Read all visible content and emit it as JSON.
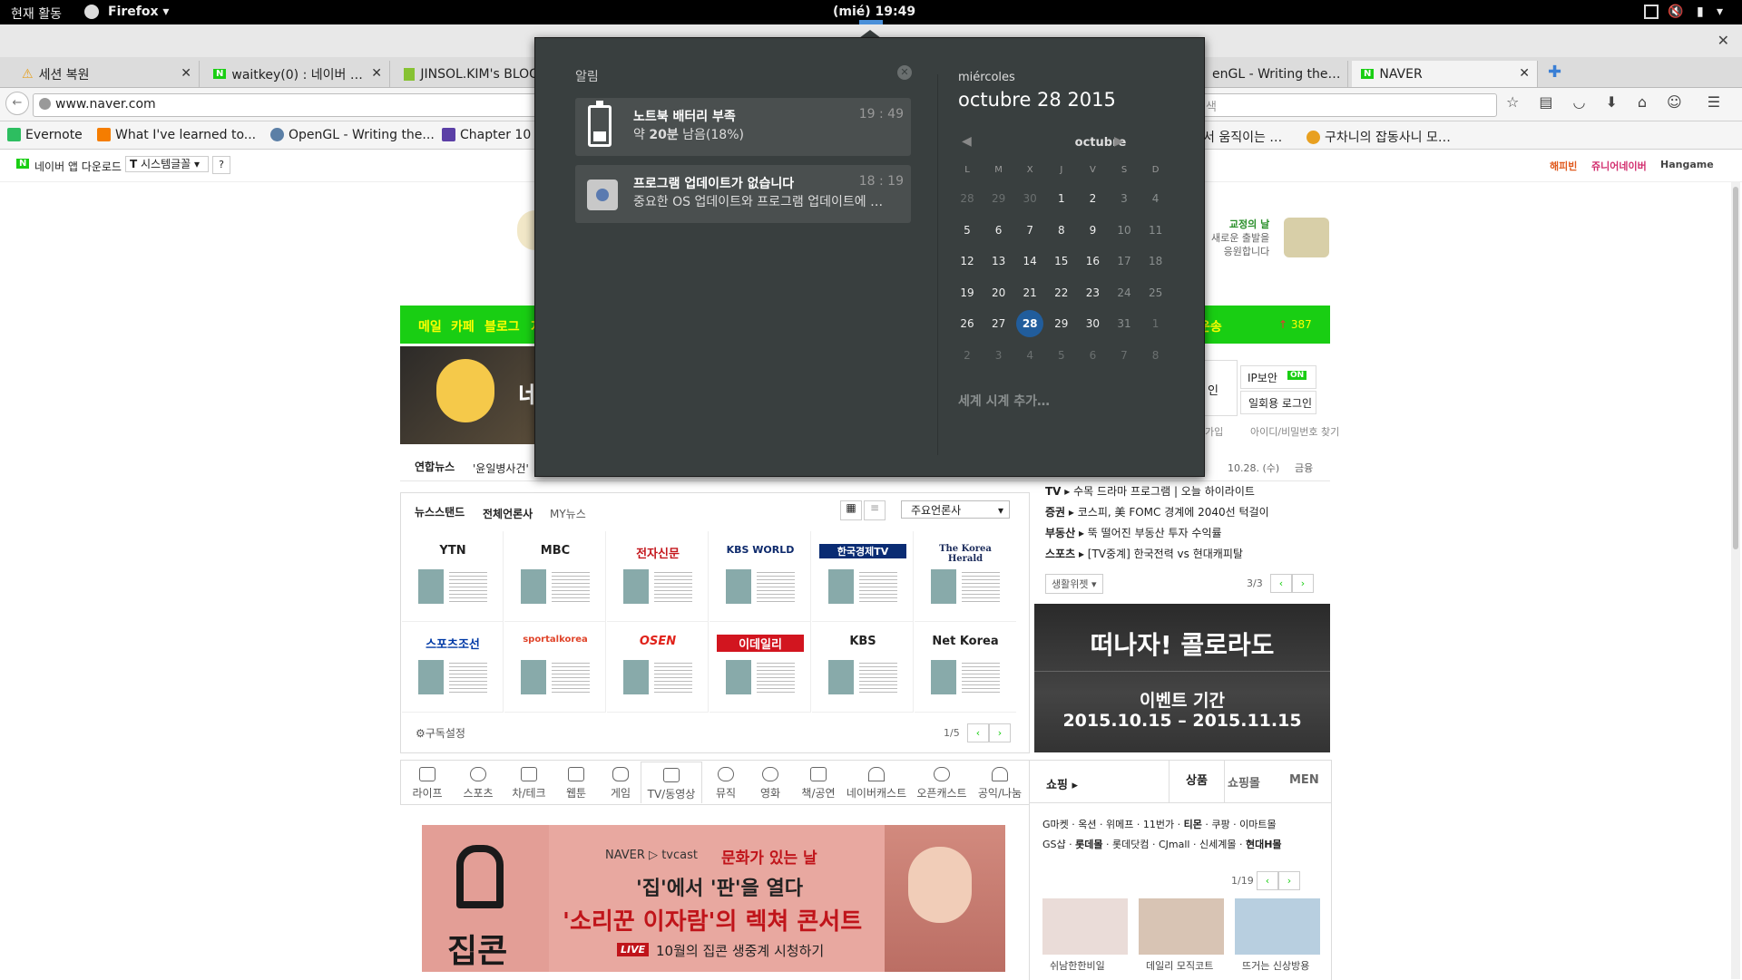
{
  "topbar": {
    "activities": "현재 활동",
    "app_name": "Firefox",
    "clock": "(mié) 19:49"
  },
  "tabs": [
    {
      "label": "세션 복원",
      "icon": "warning-icon"
    },
    {
      "label": "waitkey(0) : 네이버 …",
      "icon": "naver-icon"
    },
    {
      "label": "JINSOL.KIM's BLOG",
      "icon": "blog-icon"
    },
    {
      "label": "enGL - Writing the…",
      "icon": "opengl-icon"
    },
    {
      "label": "NAVER",
      "icon": "naver-icon"
    }
  ],
  "navbar": {
    "url": "www.naver.com",
    "search_placeholder": "색"
  },
  "bookmarks": [
    {
      "label": "Evernote",
      "color": "#2dbe60"
    },
    {
      "label": "What I've learned to...",
      "color": "#f57d00"
    },
    {
      "label": "OpenGL - Writing the...",
      "color": "#5b7fa6"
    },
    {
      "label": "Chapter 10 -",
      "color": "#5b3fa6"
    },
    {
      "label": "서 움직이는 …",
      "color": ""
    },
    {
      "label": "구차니의 잡동사니 모…",
      "color": "#e8a020"
    }
  ],
  "naver_toolbar": {
    "app_download": "네이버 앱 다운로드",
    "font_select": "시스템글꼴",
    "help": "?",
    "right_links": [
      "해피빈",
      "쥬니어네이버",
      "Hangame"
    ]
  },
  "naver": {
    "promo": {
      "line1": "교정의 날",
      "line2": "새로운 출발을",
      "line3": "응원합니다"
    },
    "menu": [
      "메일",
      "카페",
      "블로그",
      "지"
    ],
    "menu_right": "운송",
    "rank_count": "387",
    "banner_text": "네",
    "login": {
      "ip_label": "IP보안",
      "ip_state": "ON",
      "otp_label": "일회용 로그인",
      "login_tail": "인",
      "join_tail": "가입",
      "find": "아이디/비밀번호 찾기"
    },
    "yonhap": {
      "label": "연합뉴스",
      "headline": "'윤일병사건'"
    },
    "date_weather": {
      "date": "10.28. (수)",
      "tail": "금융"
    },
    "newsstand": {
      "title": "뉴스스탠드",
      "tab_all": "전체언론사",
      "tab_my": "MY뉴스",
      "dropdown": "주요언론사",
      "pager": "1/5",
      "settings": "구독설정",
      "logos": [
        "YTN",
        "MBC",
        "전자신문",
        "KBS WORLD",
        "한국경제TV",
        "The Korea Herald",
        "스포츠조선",
        "sportalkorea",
        "OSEN",
        "이데일리",
        "KBS",
        "Net Korea"
      ]
    },
    "topics": [
      {
        "cat": "TV",
        "text": "수목 드라마 프로그램 | 오늘 하이라이트"
      },
      {
        "cat": "증권",
        "text": "코스피, 美 FOMC 경계에 2040선 턱걸이"
      },
      {
        "cat": "부동산",
        "text": "뚝 떨어진 부동산 투자 수익률"
      },
      {
        "cat": "스포츠",
        "text": "[TV중계] 한국전력 vs 현대캐피탈"
      }
    ],
    "topic_widget": "생활위젯",
    "topic_pager": "3/3",
    "ad": {
      "title": "떠나자! 콜로라도",
      "line1": "이벤트 기간",
      "line2": "2015.10.15 – 2015.11.15"
    },
    "categories": [
      "라이프",
      "스포츠",
      "차/테크",
      "웹툰",
      "게임",
      "TV/동영상",
      "뮤직",
      "영화",
      "책/공연",
      "네이버캐스트",
      "오픈캐스트",
      "공익/나눔"
    ],
    "shopping": {
      "title": "쇼핑",
      "tabs": [
        "상품",
        "쇼핑몰",
        "MEN"
      ],
      "links1": [
        "G마켓",
        "옥션",
        "위메프",
        "11번가",
        "티몬",
        "쿠팡",
        "이마트몰"
      ],
      "links2": [
        "GS샵",
        "롯데몰",
        "롯데닷컴",
        "CJmall",
        "신세계몰",
        "현대H몰"
      ],
      "pager": "1/19",
      "items": [
        "쉬남한한비일",
        "데일리 모직코트",
        "뜨거는 신상방용"
      ]
    },
    "tvcast": {
      "brand": "NAVER ▷ tvcast",
      "slogan": "문화가 있는 날",
      "logo": "집콘",
      "line1": "'집'에서 '판'을 열다",
      "line2": "'소리꾼 이자람'의 렉쳐 콘서트",
      "live": "LIVE",
      "line3": "10월의 집콘 생중계 시청하기"
    }
  },
  "overlay": {
    "notifications_title": "알림",
    "notifications": [
      {
        "icon": "battery-icon",
        "title": "노트북 배터리 부족",
        "body_pre": "약 ",
        "body_bold": "20분",
        "body_post": " 남음(18%)",
        "time": "19 : 49"
      },
      {
        "icon": "software-update-icon",
        "title": "프로그램 업데이트가 없습니다",
        "body": "중요한 OS 업데이트와 프로그램 업데이트에 …",
        "time": "18 : 19"
      }
    ],
    "weekday": "miércoles",
    "date": "octubre 28 2015",
    "month": "octubre",
    "day_headers": [
      "L",
      "M",
      "X",
      "J",
      "V",
      "S",
      "D"
    ],
    "weeks": [
      [
        "28",
        "29",
        "30",
        "1",
        "2",
        "3",
        "4"
      ],
      [
        "5",
        "6",
        "7",
        "8",
        "9",
        "10",
        "11"
      ],
      [
        "12",
        "13",
        "14",
        "15",
        "16",
        "17",
        "18"
      ],
      [
        "19",
        "20",
        "21",
        "22",
        "23",
        "24",
        "25"
      ],
      [
        "26",
        "27",
        "28",
        "29",
        "30",
        "31",
        "1"
      ],
      [
        "2",
        "3",
        "4",
        "5",
        "6",
        "7",
        "8"
      ]
    ],
    "today_week": 4,
    "today_col": 2,
    "world_clocks": "세계 시계 추가…"
  }
}
